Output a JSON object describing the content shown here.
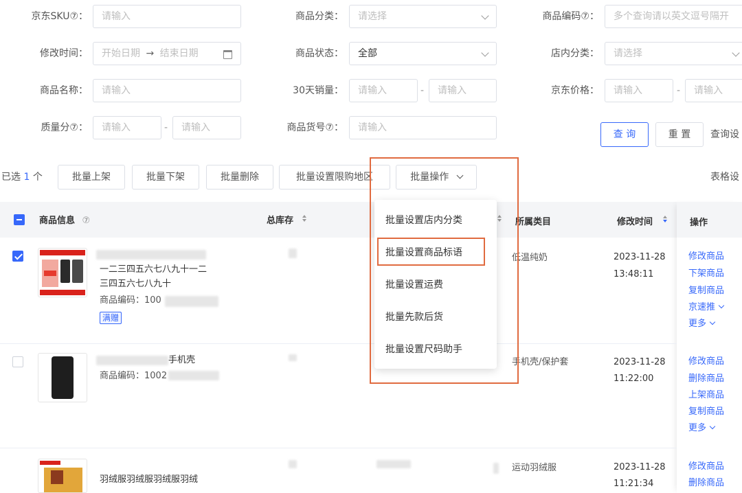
{
  "filters": {
    "sku": {
      "label": "京东SKU⑦：",
      "placeholder": "请输入"
    },
    "category": {
      "label": "商品分类：",
      "placeholder": "请选择"
    },
    "product_code": {
      "label": "商品编码⑦：",
      "placeholder": "多个查询请以英文逗号隔开"
    },
    "modified_time": {
      "label": "修改时间：",
      "start": "开始日期",
      "arrow": "→",
      "end": "结束日期"
    },
    "status": {
      "label": "商品状态：",
      "value": "全部"
    },
    "store_category": {
      "label": "店内分类：",
      "placeholder": "请选择"
    },
    "product_name": {
      "label": "商品名称：",
      "placeholder": "请输入"
    },
    "sales30": {
      "label": "30天销量：",
      "min_placeholder": "请输入",
      "max_placeholder": "请输入",
      "sep": "-"
    },
    "jd_price": {
      "label": "京东价格：",
      "min_placeholder": "请输入",
      "max_placeholder": "请输入",
      "sep": "-"
    },
    "quality_score": {
      "label": "质量分⑦：",
      "min_placeholder": "请输入",
      "max_placeholder": "请输入",
      "sep": "-"
    },
    "item_no": {
      "label": "商品货号⑦：",
      "placeholder": "请输入"
    },
    "query_button": "查 询",
    "reset_button": "重 置",
    "query_settings": "查询设"
  },
  "toolbar": {
    "selected_prefix": "已选",
    "selected_count": "1",
    "selected_suffix": "个",
    "batch_on": "批量上架",
    "batch_off": "批量下架",
    "batch_delete": "批量删除",
    "batch_region": "批量设置限购地区",
    "batch_ops": "批量操作",
    "table_settings": "表格设"
  },
  "dropdown": {
    "items": [
      "批量设置店内分类",
      "批量设置商品标语",
      "批量设置运费",
      "批量先款后货",
      "批量设置尺码助手"
    ],
    "highlighted_index": 1
  },
  "table": {
    "headers": {
      "info": "商品信息",
      "info_help": "⑦",
      "stock": "总库存",
      "category": "所属类目",
      "modified": "修改时间",
      "ops": "操作"
    },
    "rows": [
      {
        "title_line1": "一二三四五六七八九十一二",
        "title_line2": "三四五六七八九十",
        "code_label": "商品编码：100",
        "tag": "满赠",
        "category": "低温纯奶",
        "date": "2023-11-28",
        "time": "13:48:11",
        "actions": [
          "修改商品",
          "下架商品",
          "复制商品",
          "京速推",
          "更多"
        ],
        "checked": true
      },
      {
        "title_suffix": "手机壳",
        "code_label": "商品编码：1002",
        "category": "手机壳/保护套",
        "date": "2023-11-28",
        "time": "11:22:00",
        "actions": [
          "修改商品",
          "删除商品",
          "上架商品",
          "复制商品",
          "更多"
        ],
        "checked": false
      },
      {
        "title_line1": "羽绒服羽绒服羽绒服羽绒",
        "category": "运动羽绒服",
        "date": "2023-11-28",
        "time": "11:21:34",
        "actions": [
          "修改商品",
          "删除商品"
        ]
      }
    ]
  },
  "colors": {
    "primary": "#3768fa",
    "highlight": "#e06a3f",
    "header_bg": "#f4f5f7"
  }
}
